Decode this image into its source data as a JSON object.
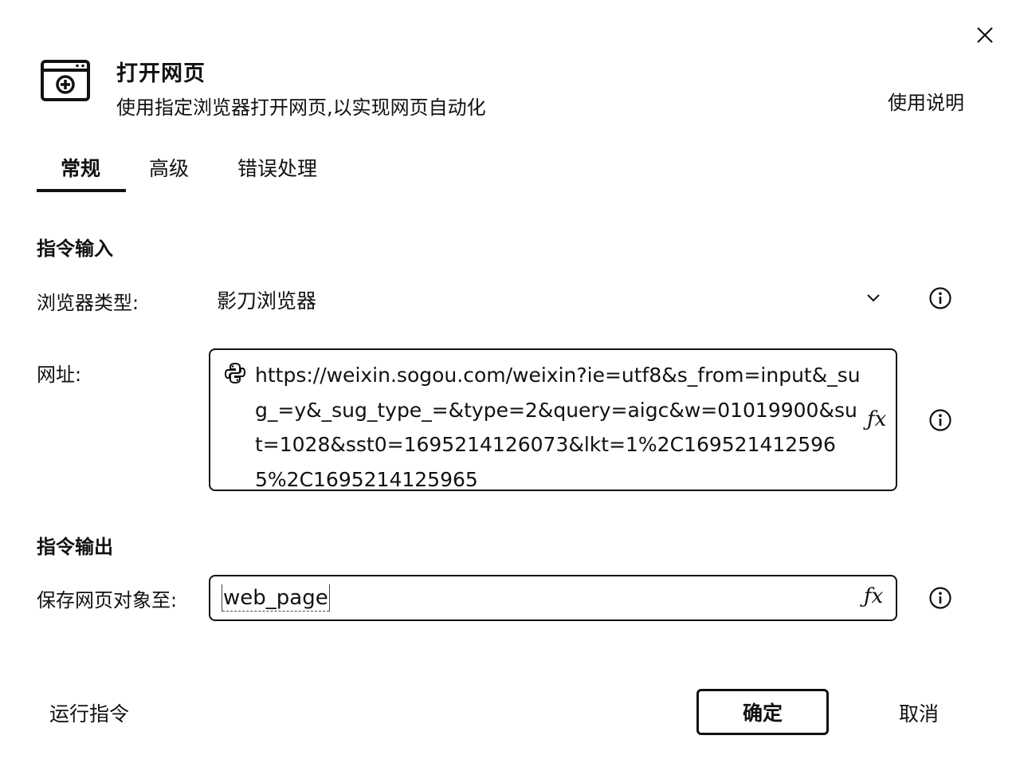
{
  "dialog": {
    "close_icon": "close-icon",
    "title": "打开网页",
    "description": "使用指定浏览器打开网页,以实现网页自动化",
    "help_label": "使用说明",
    "header_icon": "browser-window-icon"
  },
  "tabs": [
    {
      "label": "常规",
      "active": true
    },
    {
      "label": "高级",
      "active": false
    },
    {
      "label": "错误处理",
      "active": false
    }
  ],
  "input_section": {
    "title": "指令输入",
    "browser_type": {
      "label": "浏览器类型:",
      "value": "影刀浏览器"
    },
    "url": {
      "label": "网址:",
      "value": "https://weixin.sogou.com/weixin?ie=utf8&s_from=input&_sug_=y&_sug_type_=&type=2&query=aigc&w=01019900&sut=1028&sst0=1695214126073&lkt=1%2C1695214125965%2C1695214125965",
      "fx_label": "ƒx"
    }
  },
  "output_section": {
    "title": "指令输出",
    "save_to": {
      "label": "保存网页对象至:",
      "value": "web_page",
      "fx_label": "ƒx"
    }
  },
  "footer": {
    "run_label": "运行指令",
    "ok_label": "确定",
    "cancel_label": "取消"
  }
}
